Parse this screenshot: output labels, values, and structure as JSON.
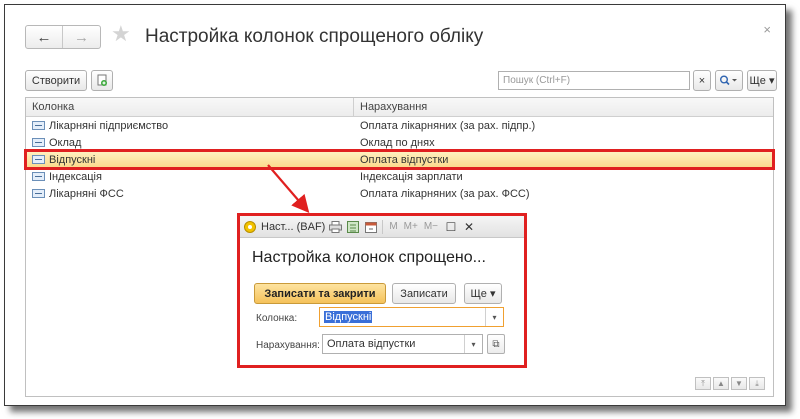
{
  "window": {
    "title": "Настройка колонок спрощеного обліку",
    "close_glyph": "×",
    "nav_back": "←",
    "nav_forward": "→",
    "star_glyph": "★"
  },
  "toolbar": {
    "create_label": "Створити",
    "search_placeholder": "Пошук (Ctrl+F)",
    "search_clear": "×",
    "search_icon": "🔍▾",
    "more_label": "Ще ▾"
  },
  "table": {
    "columns": [
      "Колонка",
      "Нарахування"
    ],
    "rows": [
      {
        "column": "Лікарняні підприємство",
        "accrual": "Оплата лікарняних (за рах. підпр.)",
        "selected": false
      },
      {
        "column": "Оклад",
        "accrual": "Оклад по днях",
        "selected": false
      },
      {
        "column": "Відпускні",
        "accrual": "Оплата відпустки",
        "selected": true
      },
      {
        "column": "Індексація",
        "accrual": "Індексація зарплати",
        "selected": false
      },
      {
        "column": "Лікарняні ФСС",
        "accrual": "Оплата лікарняних (за рах. ФСС)",
        "selected": false
      }
    ]
  },
  "scroll": {
    "first": "⤒",
    "up": "▲",
    "down": "▼",
    "last": "⤓"
  },
  "popup": {
    "titlebar_text": "Наст...  (BAF)",
    "m_label": "M",
    "mplus_label": "M+",
    "mminus_label": "M−",
    "restore_glyph": "☐",
    "close_glyph": "✕",
    "title": "Настройка колонок спрощено...",
    "save_close_label": "Записати та закрити",
    "save_label": "Записати",
    "more_label": "Ще ▾",
    "column_label": "Колонка:",
    "column_value": "Відпускні",
    "accrual_label": "Нарахування:",
    "accrual_value": "Оплата відпустки",
    "dropdown_glyph": "▾",
    "open_glyph": "⧉"
  },
  "colors": {
    "highlight_red": "#e02020",
    "selection_yellow": "#fbd98a",
    "primary_button": "#f5c25a",
    "text_selection": "#3a6fd8"
  }
}
